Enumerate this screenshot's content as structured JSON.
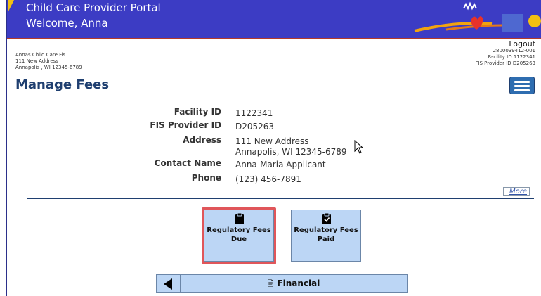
{
  "header": {
    "app_title": "Child Care Provider Portal",
    "welcome": "Welcome, Anna"
  },
  "provider": {
    "name": "Annas Child Care Fis",
    "address1": "111 New Address",
    "address2": "Annapolis , WI 12345-6789"
  },
  "account": {
    "logout_label": "Logout",
    "account_number": "2800039412-001",
    "facility_id_line": "Facility ID 1122341",
    "fis_provider_line": "FIS Provider ID D205263"
  },
  "page": {
    "title": "Manage Fees"
  },
  "details": [
    {
      "label": "Facility ID",
      "value": "1122341"
    },
    {
      "label": "FIS Provider ID",
      "value": "D205263"
    },
    {
      "label": "Address",
      "value": "111 New Address",
      "value2": "Annapolis, WI 12345-6789"
    },
    {
      "label": "Contact Name",
      "value": "Anna-Maria Applicant"
    },
    {
      "label": "Phone",
      "value": "(123) 456-7891"
    }
  ],
  "more_label": "More",
  "tiles": [
    {
      "line1": "Regulatory Fees",
      "line2": "Due",
      "icon": "clipboard-icon",
      "selected": true
    },
    {
      "line1": "Regulatory Fees",
      "line2": "Paid",
      "icon": "clipboard-check-icon",
      "selected": false
    }
  ],
  "footer_nav": {
    "label": "Financial",
    "icon": "money-icon"
  },
  "colors": {
    "header_bg": "#3c3cc4",
    "accent": "#1f3f70",
    "tile_bg": "#bcd6f5",
    "highlight": "#e0565a"
  }
}
